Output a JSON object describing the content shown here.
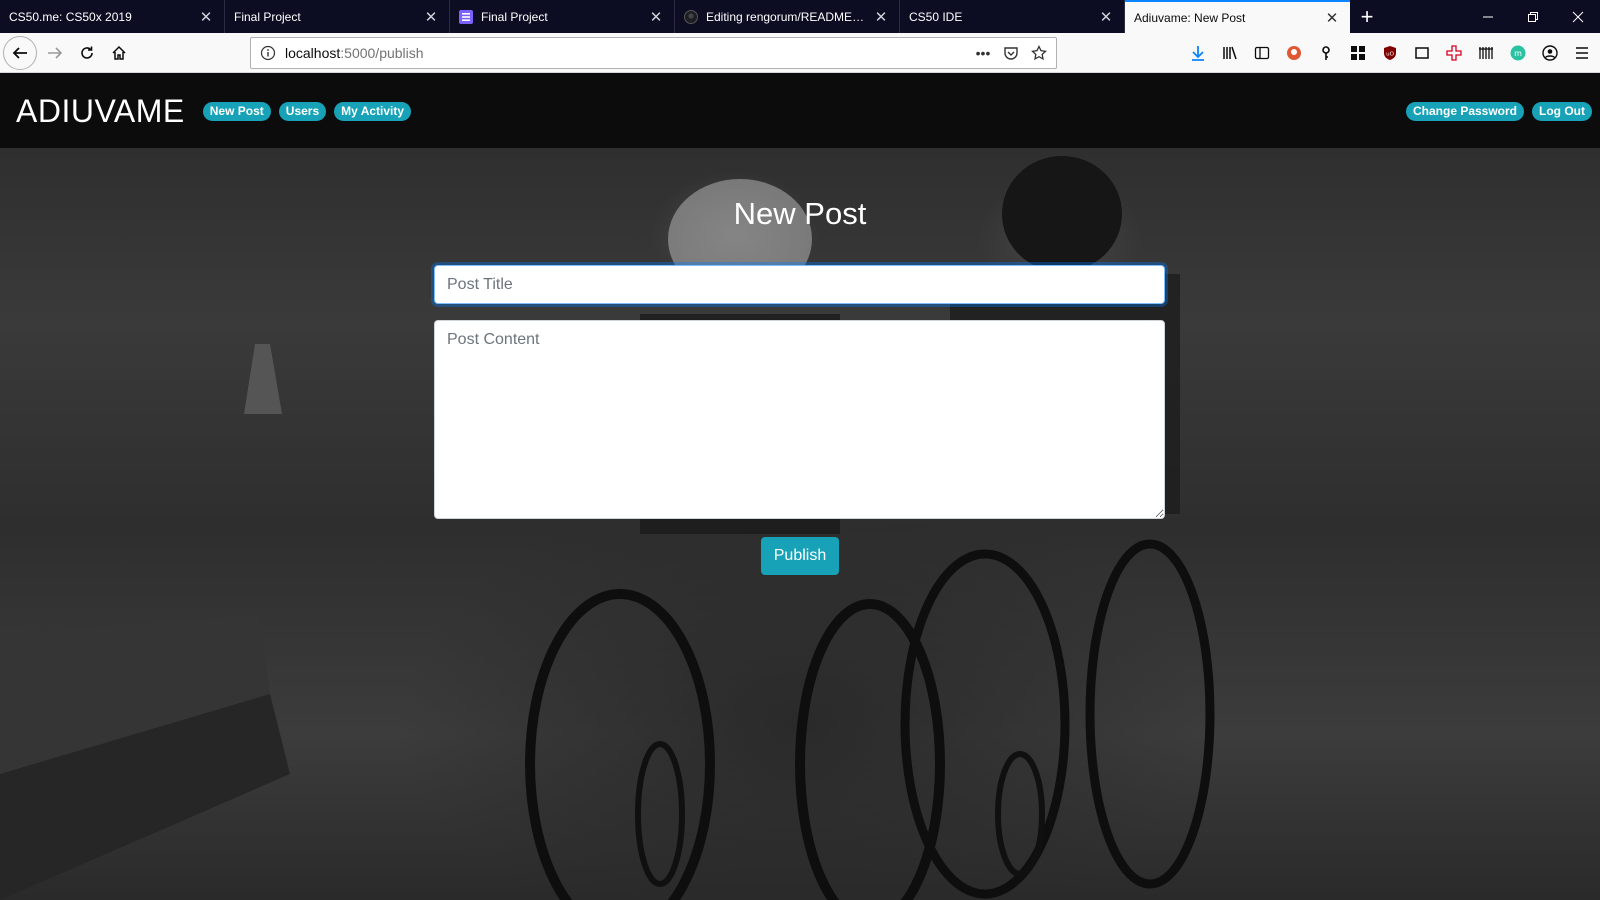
{
  "browser": {
    "tabs": [
      {
        "title": "CS50.me: CS50x 2019",
        "favicon": "none",
        "active": false
      },
      {
        "title": "Final Project",
        "favicon": "none",
        "active": false
      },
      {
        "title": "Final Project",
        "favicon": "list-icon",
        "active": false
      },
      {
        "title": "Editing rengorum/README.md",
        "favicon": "github-icon",
        "active": false
      },
      {
        "title": "CS50 IDE",
        "favicon": "none",
        "active": false
      },
      {
        "title": "Adiuvame: New Post",
        "favicon": "none",
        "active": true
      }
    ],
    "url": {
      "host": "localhost",
      "path": ":5000/publish"
    },
    "colors": {
      "tab_strip": "#0c0c22",
      "active_tab_accent": "#0a84ff",
      "toolbar": "#f9f9fa"
    }
  },
  "site": {
    "brand": "ADIUVAME",
    "nav_left": [
      "New Post",
      "Users",
      "My Activity"
    ],
    "nav_right": [
      "Change Password",
      "Log Out"
    ],
    "accent": "#17a2b8"
  },
  "form": {
    "heading": "New Post",
    "title_placeholder": "Post Title",
    "content_placeholder": "Post Content",
    "submit_label": "Publish"
  }
}
